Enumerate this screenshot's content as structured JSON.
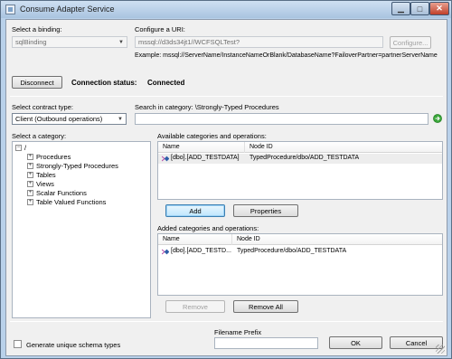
{
  "window": {
    "title": "Consume Adapter Service",
    "minimize_glyph": "▁",
    "maximize_glyph": "□",
    "close_glyph": "✕"
  },
  "binding": {
    "label": "Select a binding:",
    "value": "sqlBinding"
  },
  "uri": {
    "label": "Configure a URI:",
    "value": "mssql://d3ds34jt1//WCFSQLTest?",
    "configure_label": "Configure...",
    "example": "Example: mssql://ServerName/InstanceNameOrBlank/DatabaseName?FailoverPartner=partnerServerName"
  },
  "connection": {
    "disconnect_label": "Disconnect",
    "status_label": "Connection status:",
    "status_value": "Connected"
  },
  "contract": {
    "label": "Select contract type:",
    "value": "Client (Outbound operations)"
  },
  "search": {
    "label": "Search in category: \\Strongly-Typed Procedures",
    "value": "",
    "go_icon": "go-arrow-icon"
  },
  "category": {
    "label": "Select a category:",
    "root": "/",
    "items": [
      {
        "label": "Procedures"
      },
      {
        "label": "Strongly-Typed Procedures"
      },
      {
        "label": "Tables"
      },
      {
        "label": "Views"
      },
      {
        "label": "Scalar Functions"
      },
      {
        "label": "Table Valued Functions"
      }
    ]
  },
  "available": {
    "label": "Available categories and operations:",
    "col_name": "Name",
    "col_node": "Node ID",
    "rows": [
      {
        "name": "[dbo].[ADD_TESTDATA]",
        "node": "TypedProcedure/dbo/ADD_TESTDATA"
      }
    ],
    "add_label": "Add",
    "properties_label": "Properties"
  },
  "added": {
    "label": "Added categories and operations:",
    "col_name": "Name",
    "col_node": "Node ID",
    "rows": [
      {
        "name": "[dbo].[ADD_TESTD...",
        "node": "TypedProcedure/dbo/ADD_TESTDATA"
      }
    ],
    "remove_label": "Remove",
    "remove_all_label": "Remove All"
  },
  "footer": {
    "unique_schema_label": "Generate unique schema types",
    "filename_prefix_label": "Filename Prefix",
    "filename_prefix_value": "",
    "ok_label": "OK",
    "cancel_label": "Cancel"
  }
}
